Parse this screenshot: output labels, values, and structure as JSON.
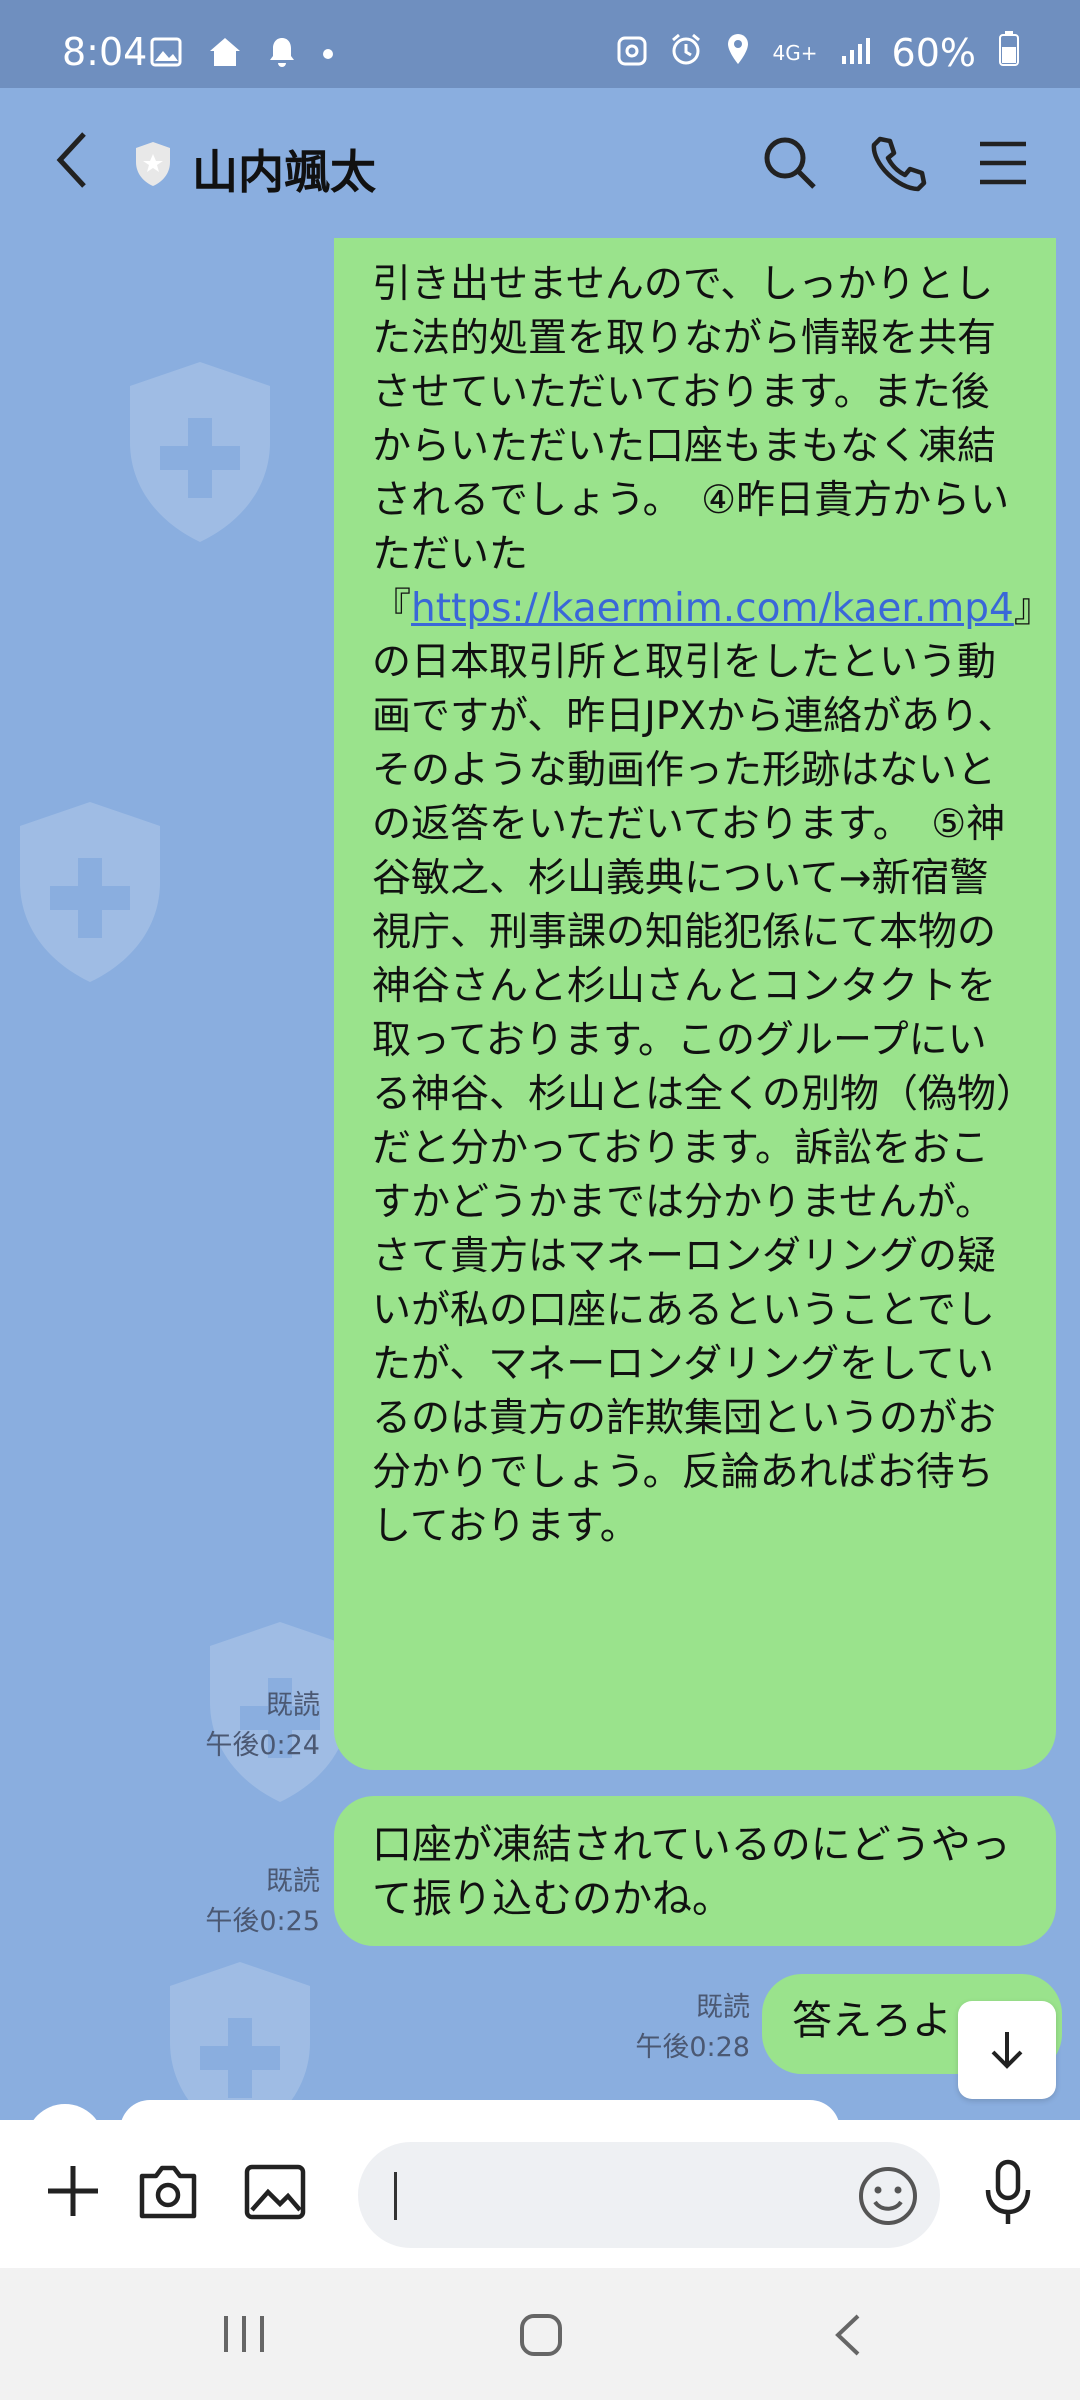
{
  "status_bar": {
    "time": "8:04",
    "network": "4G+",
    "battery": "60%",
    "icons": [
      "gallery-icon",
      "home-icon",
      "bell-icon",
      "dot-icon",
      "recycle-icon",
      "alarm-icon",
      "location-icon",
      "signal-icon",
      "battery-icon"
    ]
  },
  "header": {
    "title": "山内颯太",
    "icons": [
      "back-arrow-icon",
      "shield-star-icon",
      "search-icon",
      "phone-icon",
      "menu-icon"
    ]
  },
  "messages": [
    {
      "text_before_link": "引き出せませんので、しっかりとした法的処置を取りながら情報を共有させていただいております。また後からいただいた口座もまもなく凍結されるでしょう。　④昨日貴方からいただいた『",
      "link": "https://kaermim.com/kaer.mp4",
      "text_after_link": "』の日本取引所と取引をしたという動画ですが、昨日JPXから連絡があり、そのような動画作った形跡はないとの返答をいただいております。　⑤神谷敏之、杉山義典について→新宿警視庁、刑事課の知能犯係にて本物の神谷さんと杉山さんとコンタクトを取っております。このグループにいる神谷、杉山とは全くの別物（偽物）だと分かっております。訴訟をおこすかどうかまでは分かりませんが。さて貴方はマネーロンダリングの疑いが私の口座にあるということでしたが、マネーロンダリングをしているのは貴方の詐欺集団というのがお分かりでしょう。反論あればお待ちしております。",
      "read": "既読",
      "time": "午後0:24"
    },
    {
      "text": "口座が凍結されているのにどうやって振り込むのかね。",
      "read": "既読",
      "time": "午後0:25"
    },
    {
      "text": "答えろよ",
      "read": "既読",
      "time": "午後0:28"
    }
  ],
  "input": {
    "placeholder": "",
    "icons": [
      "plus-icon",
      "camera-icon",
      "image-icon",
      "emoji-icon",
      "mic-icon"
    ]
  },
  "colors": {
    "chat_bg": "#8aaedf",
    "bubble_green": "#9ae38c",
    "status_bar": "#6f8fbf",
    "link": "#3a67d8"
  }
}
